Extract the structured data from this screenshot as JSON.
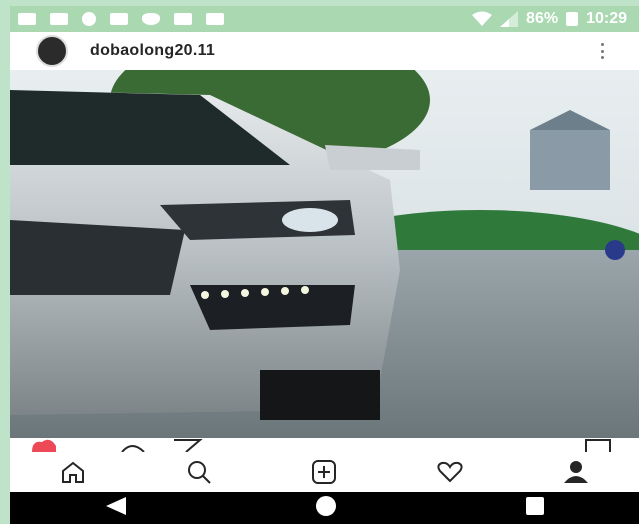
{
  "status_bar": {
    "battery": "86%",
    "time": "10:29"
  },
  "post": {
    "username": "dobaolong20.11"
  },
  "icons": {
    "notification_icons": [
      "notification-icon",
      "notification-icon",
      "messenger-icon",
      "gallery-icon",
      "heart-icon",
      "image-icon",
      "calendar-icon"
    ],
    "nav": [
      "home-icon",
      "search-icon",
      "add-post-icon",
      "activity-icon",
      "profile-icon"
    ],
    "system_nav": [
      "back-icon",
      "home-circle-icon",
      "recents-icon"
    ]
  },
  "colors": {
    "like_red": "#ed4956",
    "status_bar_bg": "#a9d8b1"
  }
}
